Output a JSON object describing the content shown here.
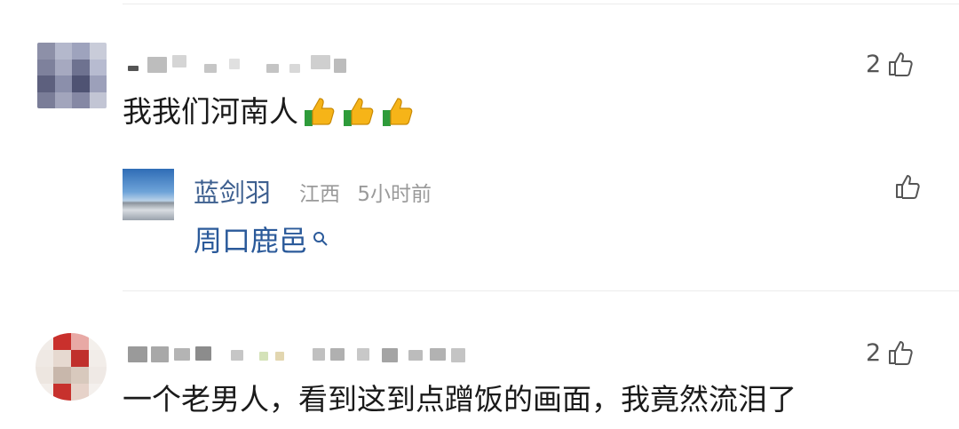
{
  "comments": [
    {
      "text": "我我们河南人",
      "like_count": "2",
      "emoji": [
        "thumbs-up",
        "thumbs-up",
        "thumbs-up"
      ],
      "reply": {
        "author": "蓝剑羽",
        "location": "江西",
        "time": "5小时前",
        "text": "周口鹿邑",
        "text_icon": "search-icon"
      }
    },
    {
      "text": "一个老男人，看到这到点蹭饭的画面，我竟然流泪了",
      "like_count": "2"
    }
  ],
  "colors": {
    "reply_name": "#3d5f8f",
    "reply_link": "#2b5a9a",
    "meta": "#9a9a9a",
    "divider": "#ececec"
  }
}
